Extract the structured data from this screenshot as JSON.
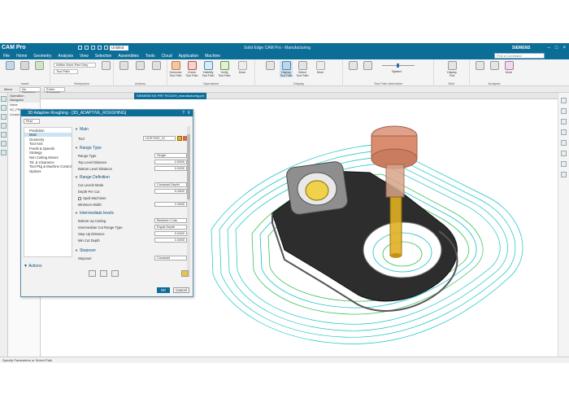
{
  "app": {
    "name": "CAM Pro",
    "window_title": "Solid Edge CAM Pro - Manufacturing",
    "brand": "SIEMENS",
    "part_dropdown": "Untitled"
  },
  "menu": [
    "File",
    "Home",
    "Geometry",
    "Analysis",
    "View",
    "Selection",
    "Assemblies",
    "Tools",
    "Cloud",
    "Application",
    "Machine"
  ],
  "search_placeholder": "Find a Command",
  "ribbon": {
    "groups": [
      {
        "label": "Insert"
      },
      {
        "label": "Workpiece"
      },
      {
        "label": "Actions"
      },
      {
        "label": "Operations"
      },
      {
        "label": "Display"
      },
      {
        "label": "Tool Path Animation"
      },
      {
        "label": "NAV"
      },
      {
        "label": "Analysis"
      }
    ],
    "buttons": [
      {
        "label": "Generate Tool Path"
      },
      {
        "label": "Check Tool Path"
      },
      {
        "label": "Visibility Tool Path"
      },
      {
        "label": "Verify Tool Path"
      },
      {
        "label": "More"
      },
      {
        "label": "Display Tool Path"
      },
      {
        "label": "Select Tool Path"
      },
      {
        "label": "More"
      },
      {
        "label": "Speed"
      },
      {
        "label": "Display Tool"
      },
      {
        "label": "More"
      }
    ],
    "dropdown_main": "Within Work Part Only",
    "dropdown_small": "Tool Path",
    "speed_label": "Speed"
  },
  "command_bar": {
    "menu": "Menu",
    "selection_filter": "No Selection Filter",
    "scope": "Entire Assembly"
  },
  "nav_panel": {
    "title": "Operation Navigator",
    "rows": [
      "Name",
      "NC_PROGRAM",
      "Unused Items"
    ]
  },
  "doc_tabs": [
    {
      "label": "SIEMENS NX PRT ROUGH_manufacturing.prt",
      "active": true
    }
  ],
  "dialog": {
    "title": "3D Adaptive Roughing - [3D_ADAPTIVE_ROUGHING]",
    "help": "?",
    "close": "X",
    "find": "Find",
    "nav_list": [
      "Prediction",
      "Main",
      "Geometry",
      "Tool Axis",
      "Feeds & Speeds",
      "Strategy",
      "Non Cutting Moves",
      "Tol. & Clearance",
      "Tool Pkg & Machine Control",
      "Options"
    ],
    "selected_index": 1,
    "sections": {
      "main": "Main",
      "range_type": "Range Type",
      "range_definition": "Range Definition",
      "intermediate": "Intermediate levels",
      "stepover": "Stepover",
      "actions": "Actions"
    },
    "fields": {
      "tool_label": "Tool",
      "tool_value": "UCE7020_12",
      "range_type_label": "Range Type",
      "range_type_value": "Single",
      "top_level_label": "Top Level Distance",
      "top_level_value": "2.5000",
      "bottom_level_label": "Bottom Level Distance",
      "bottom_level_value": "0.0000",
      "cut_levels_label": "Cut Levels Mode",
      "cut_levels_value": "Constant Depth",
      "depth_per_cut_label": "Depth Per Cut",
      "depth_per_cut_value": "0.2500",
      "spoil_label": "Spoil Machines",
      "min_width_label": "Minimum Width",
      "min_width_value": "1.0000",
      "bottom_up_label": "Bottom Up Cutting",
      "bottom_up_value": "Between Cuts",
      "intermediate_range_label": "Intermediate Cut Range Type",
      "intermediate_range_value": "Equal Depth",
      "step_up_label": "Step Up Distance",
      "step_up_value": "0.0000",
      "min_cut_label": "Min Cut Depth",
      "min_cut_value": "1.0000",
      "stepover_label": "Stepover",
      "stepover_value": "Constant"
    },
    "ok": "OK",
    "cancel": "Cancel"
  },
  "status_bar": "Specify Parameters or Select Path",
  "colors": {
    "accent": "#0c6d97",
    "toolpath_cyan": "#12c2c8",
    "toolpath_green": "#36c25a",
    "part_dark": "#3a3a3a",
    "part_grey": "#9a9a9a",
    "tool_holder": "#d98c6e",
    "tool_cutter": "#e0b022"
  }
}
